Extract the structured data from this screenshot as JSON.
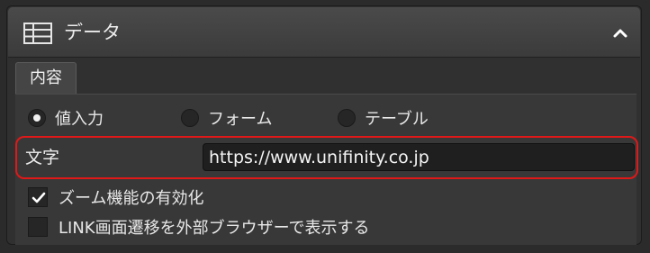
{
  "panel": {
    "title": "データ",
    "header_icon": "table-icon",
    "collapse_icon": "chevron-up-icon"
  },
  "tabs": [
    {
      "label": "内容",
      "selected": true
    }
  ],
  "data_source": {
    "options": [
      {
        "label": "値入力",
        "selected": true
      },
      {
        "label": "フォーム",
        "selected": false
      },
      {
        "label": "テーブル",
        "selected": false
      }
    ]
  },
  "text_field": {
    "label": "文字",
    "value": "https://www.unifinity.co.jp",
    "highlight_color": "#e01818"
  },
  "options": {
    "zoom": {
      "label": "ズーム機能の有効化",
      "checked": true
    },
    "external_browser": {
      "label": "LINK画面遷移を外部ブラウザーで表示する",
      "checked": false
    }
  }
}
